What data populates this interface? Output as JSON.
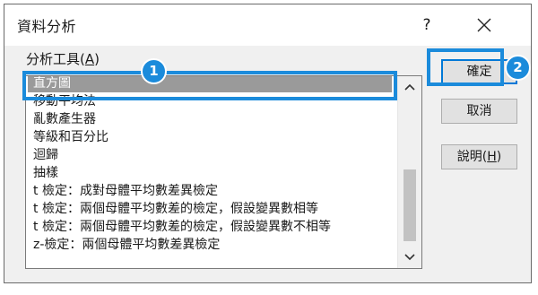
{
  "dialog": {
    "title": "資料分析",
    "help_label": "?",
    "close_icon": "close-icon"
  },
  "tools": {
    "label_text": "分析工具(",
    "label_access_key": "A",
    "label_suffix": ")",
    "items": [
      "直方圖",
      "移動平均法",
      "亂數產生器",
      "等級和百分比",
      "迴歸",
      "抽樣",
      "t 檢定：成對母體平均數差異檢定",
      "t 檢定：兩個母體平均數差的檢定，假設變異數相等",
      "t 檢定：兩個母體平均數差的檢定，假設變異數不相等",
      "z-檢定：兩個母體平均數差異檢定"
    ],
    "selected_index": 0
  },
  "buttons": {
    "ok": "確定",
    "cancel": "取消",
    "help_text": "說明(",
    "help_access_key": "H",
    "help_suffix": ")"
  },
  "annotations": {
    "badge_1": "1",
    "badge_2": "2",
    "color": "#1b8bdb"
  }
}
